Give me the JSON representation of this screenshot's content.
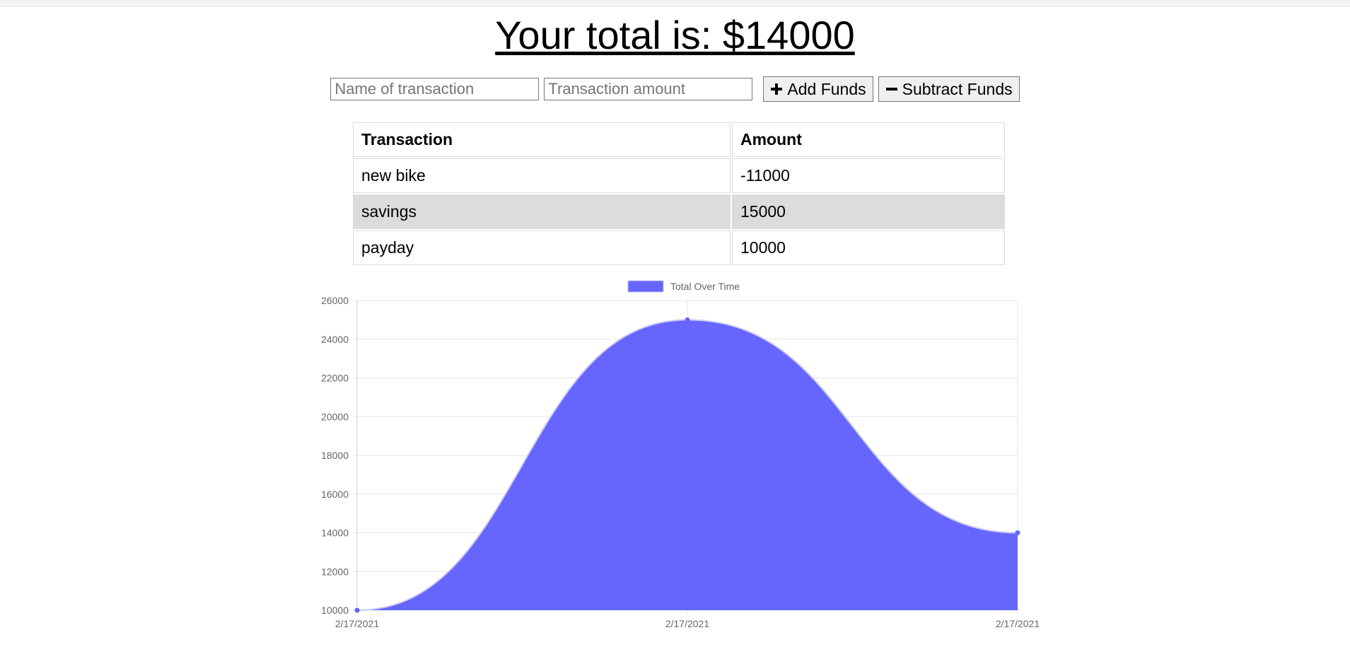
{
  "header": {
    "title": "Your total is: $14000"
  },
  "form": {
    "name_placeholder": "Name of transaction",
    "amount_placeholder": "Transaction amount",
    "add_label": "Add Funds",
    "subtract_label": "Subtract Funds"
  },
  "table": {
    "columns": [
      "Transaction",
      "Amount"
    ],
    "rows": [
      {
        "name": "new bike",
        "amount": "-11000"
      },
      {
        "name": "savings",
        "amount": "15000"
      },
      {
        "name": "payday",
        "amount": "10000"
      }
    ]
  },
  "colors": {
    "fill": "#6666ff",
    "stroke": "#c9c9f0"
  },
  "chart_data": {
    "type": "area",
    "legend": "Total Over Time",
    "legend_position": "top",
    "categories": [
      "2/17/2021",
      "2/17/2021",
      "2/17/2021"
    ],
    "series": [
      {
        "name": "Total Over Time",
        "values": [
          10000,
          25000,
          14000
        ]
      }
    ],
    "ylim": [
      10000,
      26000
    ],
    "yticks": [
      10000,
      12000,
      14000,
      16000,
      18000,
      20000,
      22000,
      24000,
      26000
    ],
    "grid": true,
    "smooth": true
  }
}
